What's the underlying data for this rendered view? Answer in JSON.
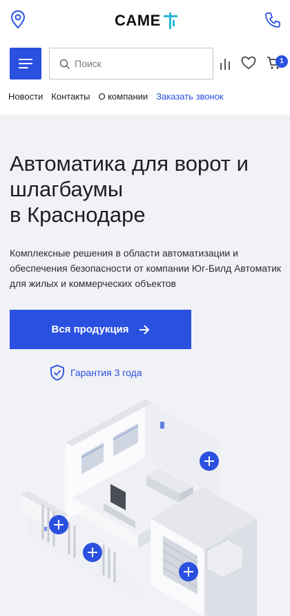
{
  "brand": {
    "logo_text": "CAME",
    "accent": "#2a50e0"
  },
  "header": {
    "icons": {
      "location": "location-pin-icon",
      "phone": "phone-icon",
      "menu": "hamburger-menu-icon",
      "search": "search-icon",
      "compare": "compare-stats-icon",
      "favorites": "heart-icon",
      "cart": "cart-icon"
    },
    "search_placeholder": "Поиск",
    "cart_count": "1",
    "nav": [
      "Новости",
      "Контакты",
      "О компании",
      "Заказать звонок"
    ]
  },
  "hero": {
    "title_line1": "Автоматика для ворот и",
    "title_line2": "шлагбаумы",
    "title_line3": "в Краснодаре",
    "description": "Комплексные решения в области автоматизации и обеспечения безопасности от компании Юг-Билд Автоматик для жилых и коммерческих объектов",
    "cta_label": "Вся продукция",
    "warranty_label": "Гарантия 3 года"
  }
}
